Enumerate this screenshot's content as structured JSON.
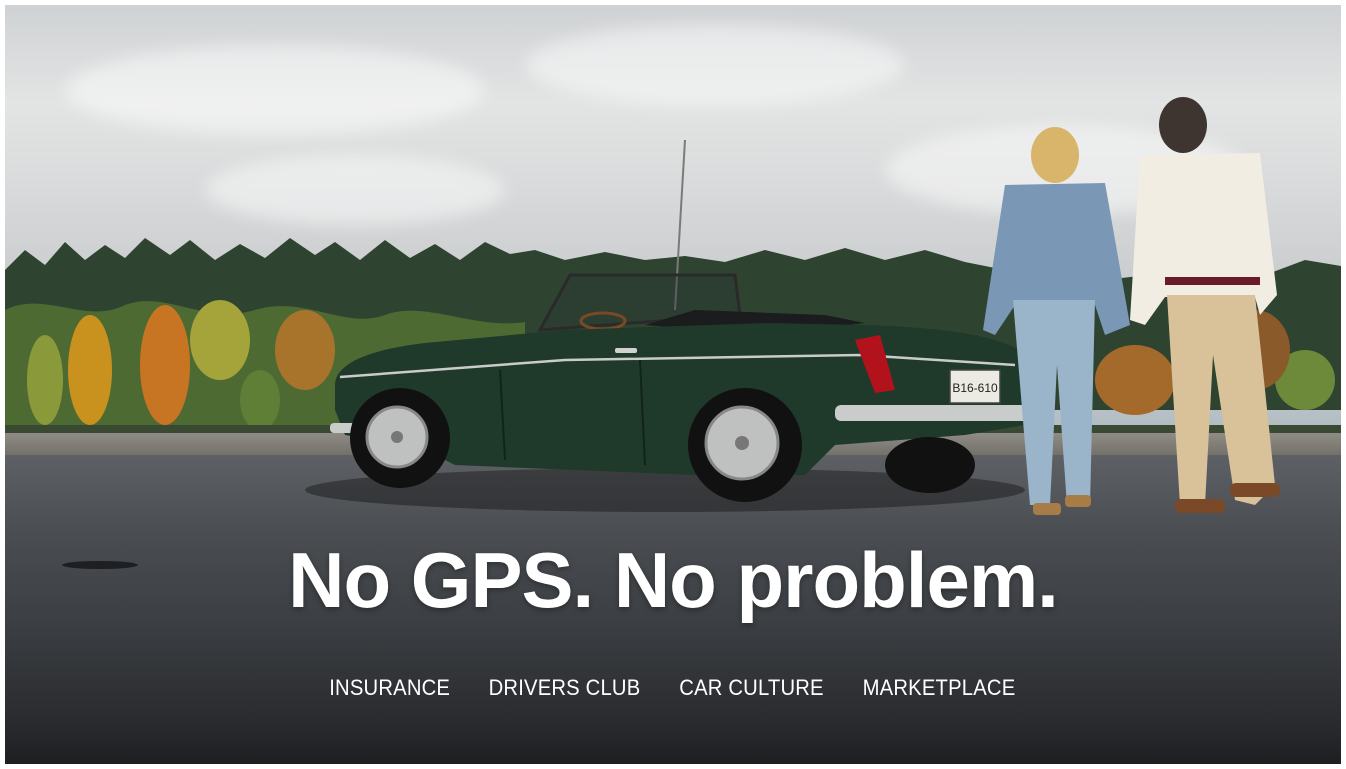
{
  "hero": {
    "headline": "No GPS. No problem.",
    "license_plate": "B16-610",
    "image_alt": "Green vintage convertible parked by the water with an older couple walking hand in hand"
  },
  "nav": {
    "items": [
      {
        "label": "INSURANCE"
      },
      {
        "label": "DRIVERS CLUB"
      },
      {
        "label": "CAR CULTURE"
      },
      {
        "label": "MARKETPLACE"
      }
    ]
  },
  "colors": {
    "headline_text": "#ffffff",
    "car_green": "#1f3a2b",
    "road": "#3b3e42"
  }
}
